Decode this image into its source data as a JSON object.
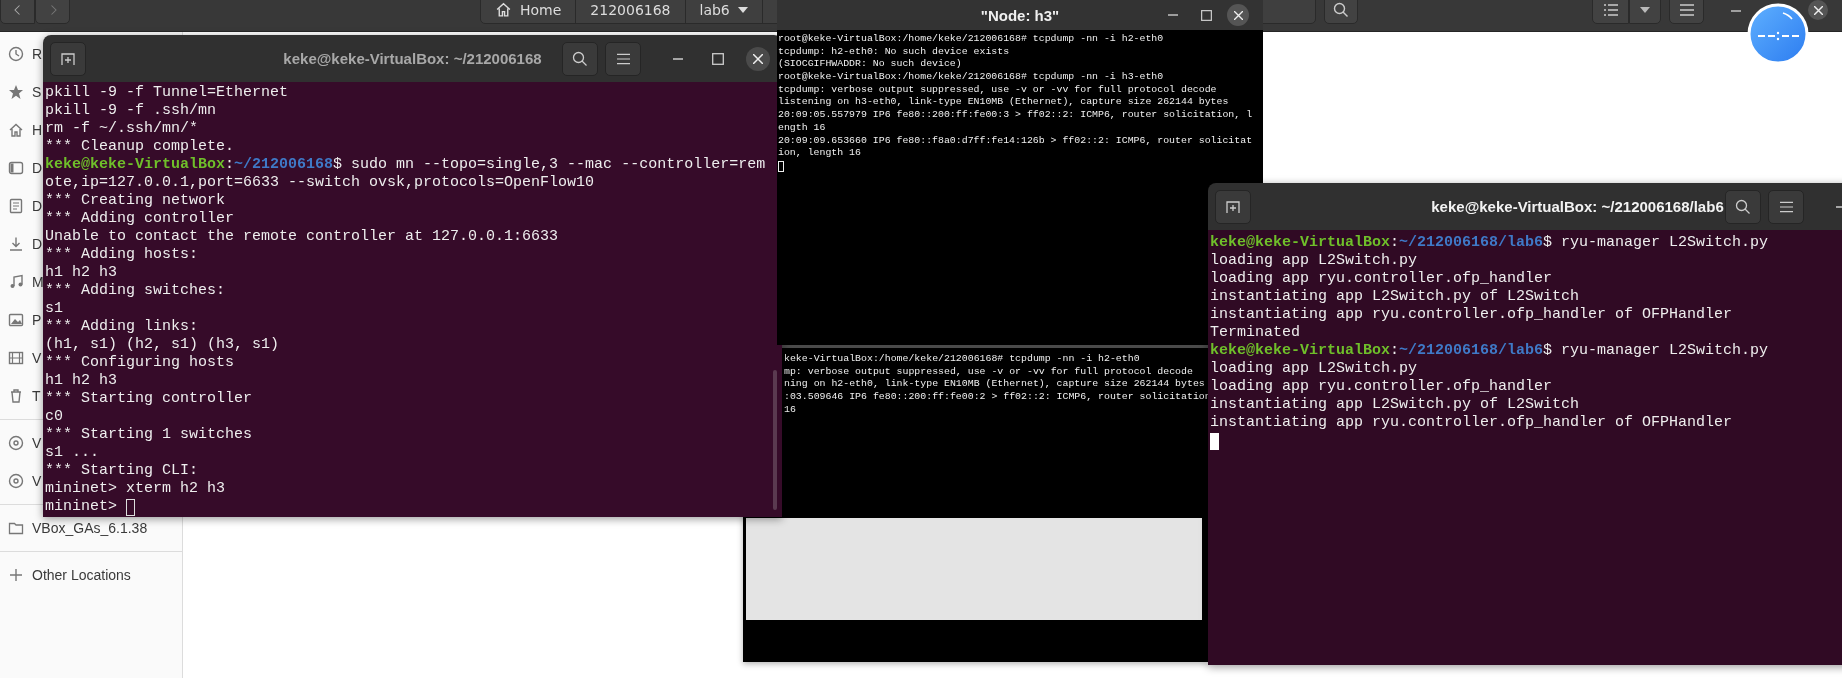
{
  "file_manager": {
    "path": [
      "Home",
      "212006168",
      "lab6"
    ],
    "sidebar": [
      {
        "items": [
          "R",
          "S",
          "H",
          "D",
          "D",
          "D",
          "M",
          "P",
          "V",
          "T"
        ]
      },
      {
        "items": [
          "V",
          "V"
        ]
      },
      {
        "items": [
          "VBox_GAs_6.1.38"
        ]
      },
      {
        "items": [
          "Other Locations"
        ]
      }
    ]
  },
  "terminal_main": {
    "title": "keke@keke-VirtualBox: ~/212006168",
    "active": false,
    "lines": [
      {
        "kind": "output",
        "text": "pkill -9 -f Tunnel=Ethernet"
      },
      {
        "kind": "output",
        "text": "pkill -9 -f .ssh/mn"
      },
      {
        "kind": "output",
        "text": "rm -f ~/.ssh/mn/*"
      },
      {
        "kind": "output",
        "text": "*** Cleanup complete."
      },
      {
        "kind": "prompt",
        "user": "keke@keke-VirtualBox",
        "sep": ":",
        "path": "~/212006168",
        "symbol": "$",
        "command": "sudo mn --topo=single,3 --mac --controller=rem"
      },
      {
        "kind": "output",
        "text": "ote,ip=127.0.0.1,port=6633 --switch ovsk,protocols=OpenFlow10"
      },
      {
        "kind": "output",
        "text": "*** Creating network"
      },
      {
        "kind": "output",
        "text": "*** Adding controller"
      },
      {
        "kind": "output",
        "text": "Unable to contact the remote controller at 127.0.0.1:6633"
      },
      {
        "kind": "output",
        "text": "*** Adding hosts:"
      },
      {
        "kind": "output",
        "text": "h1 h2 h3"
      },
      {
        "kind": "output",
        "text": "*** Adding switches:"
      },
      {
        "kind": "output",
        "text": "s1"
      },
      {
        "kind": "output",
        "text": "*** Adding links:"
      },
      {
        "kind": "output",
        "text": "(h1, s1) (h2, s1) (h3, s1)"
      },
      {
        "kind": "output",
        "text": "*** Configuring hosts"
      },
      {
        "kind": "output",
        "text": "h1 h2 h3"
      },
      {
        "kind": "output",
        "text": "*** Starting controller"
      },
      {
        "kind": "output",
        "text": "c0"
      },
      {
        "kind": "output",
        "text": "*** Starting 1 switches"
      },
      {
        "kind": "output",
        "text": "s1 ..."
      },
      {
        "kind": "output",
        "text": "*** Starting CLI:"
      },
      {
        "kind": "output",
        "text": "mininet> xterm h2 h3"
      },
      {
        "kind": "input",
        "text": "mininet>"
      }
    ]
  },
  "xterm_h3": {
    "title": "\"Node: h3\"",
    "active": false,
    "lines": [
      {
        "kind": "output",
        "text": "root@keke-VirtualBox:/home/keke/212006168# tcpdump -nn -i h2-eth0"
      },
      {
        "kind": "output",
        "text": "tcpdump: h2-eth0: No such device exists"
      },
      {
        "kind": "output",
        "text": "(SIOCGIFHWADDR: No such device)"
      },
      {
        "kind": "output",
        "text": "root@keke-VirtualBox:/home/keke/212006168# tcpdump -nn -i h3-eth0"
      },
      {
        "kind": "output",
        "text": "tcpdump: verbose output suppressed, use -v or -vv for full protocol decode"
      },
      {
        "kind": "output",
        "text": "listening on h3-eth0, link-type EN10MB (Ethernet), capture size 262144 bytes"
      },
      {
        "kind": "output",
        "text": "20:09:05.557979 IP6 fe80::200:ff:fe00:3 > ff02::2: ICMP6, router solicitation, l"
      },
      {
        "kind": "output",
        "text": "ength 16"
      },
      {
        "kind": "output",
        "text": "20:09:09.653660 IP6 fe80::f8a0:d7ff:fe14:126b > ff02::2: ICMP6, router solicitat"
      },
      {
        "kind": "output",
        "text": "ion, length 16"
      },
      {
        "kind": "cursor"
      }
    ]
  },
  "xterm_h2": {
    "lines": [
      {
        "kind": "output",
        "text": "keke-VirtualBox:/home/keke/212006168# tcpdump -nn -i h2-eth0"
      },
      {
        "kind": "output",
        "text": "mp: verbose output suppressed, use -v or -vv for full protocol decode"
      },
      {
        "kind": "output",
        "text": "ning on h2-eth0, link-type EN10MB (Ethernet), capture size 262144 bytes"
      },
      {
        "kind": "output",
        "text": ":03.509646 IP6 fe80::200:ff:fe00:2 > ff02::2: ICMP6, router solicitation"
      },
      {
        "kind": "output",
        "text": "16"
      }
    ]
  },
  "terminal_ryu": {
    "title": "keke@keke-VirtualBox: ~/212006168/lab6",
    "active": true,
    "lines": [
      {
        "kind": "prompt",
        "user": "keke@keke-VirtualBox",
        "sep": ":",
        "path": "~/212006168/lab6",
        "symbol": "$",
        "command": "ryu-manager L2Switch.py"
      },
      {
        "kind": "output",
        "text": "loading app L2Switch.py"
      },
      {
        "kind": "output",
        "text": "loading app ryu.controller.ofp_handler"
      },
      {
        "kind": "output",
        "text": "instantiating app L2Switch.py of L2Switch"
      },
      {
        "kind": "output",
        "text": "instantiating app ryu.controller.ofp_handler of OFPHandler"
      },
      {
        "kind": "output",
        "text": "Terminated"
      },
      {
        "kind": "prompt",
        "user": "keke@keke-VirtualBox",
        "sep": ":",
        "path": "~/212006168/lab6",
        "symbol": "$",
        "command": "ryu-manager L2Switch.py"
      },
      {
        "kind": "output",
        "text": "loading app L2Switch.py"
      },
      {
        "kind": "output",
        "text": "loading app ryu.controller.ofp_handler"
      },
      {
        "kind": "output",
        "text": "instantiating app L2Switch.py of L2Switch"
      },
      {
        "kind": "output",
        "text": "instantiating app ryu.controller.ofp_handler of OFPHandler"
      },
      {
        "kind": "cursor"
      }
    ]
  }
}
